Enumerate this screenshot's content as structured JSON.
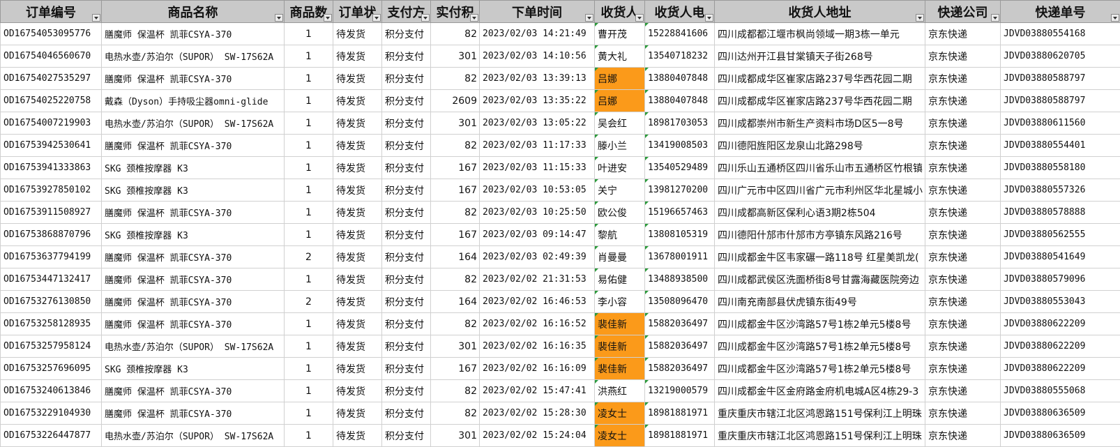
{
  "headers": [
    "订单编号",
    "商品名称",
    "商品数",
    "订单状",
    "支付方",
    "实付积",
    "下单时间",
    "收货人",
    "收货人电",
    "收货人地址",
    "快递公司",
    "快递单号"
  ],
  "rows": [
    {
      "order_id": "OD16754053095776",
      "product": "膳魔师 保温杯 凯菲CSYA-370",
      "qty": "1",
      "status": "待发货",
      "pay": "积分支付",
      "points": "82",
      "time": "2023/02/03 14:21:49",
      "name": "曹开茂",
      "phone": "15228841606",
      "address": "四川成都都江堰市枫尚领域一期3栋一单元",
      "courier": "京东快递",
      "tracking": "JDVD03880554168",
      "name_highlight": false
    },
    {
      "order_id": "OD16754046560670",
      "product": "电热水壶/苏泊尔（SUPOR） SW-17S62A",
      "qty": "1",
      "status": "待发货",
      "pay": "积分支付",
      "points": "301",
      "time": "2023/02/03 14:10:56",
      "name": "黄大礼",
      "phone": "13540718232",
      "address": "四川达州开江县甘棠镇天子街268号",
      "courier": "京东快递",
      "tracking": "JDVD03880620705",
      "name_highlight": false
    },
    {
      "order_id": "OD16754027535297",
      "product": "膳魔师 保温杯 凯菲CSYA-370",
      "qty": "1",
      "status": "待发货",
      "pay": "积分支付",
      "points": "82",
      "time": "2023/02/03 13:39:13",
      "name": "吕娜",
      "phone": "13880407848",
      "address": "四川成都成华区崔家店路237号华西花园二期",
      "courier": "京东快递",
      "tracking": "JDVD03880588797",
      "name_highlight": true
    },
    {
      "order_id": "OD16754025220758",
      "product": "戴森（Dyson）手持吸尘器omni-glide",
      "qty": "1",
      "status": "待发货",
      "pay": "积分支付",
      "points": "2609",
      "time": "2023/02/03 13:35:22",
      "name": "吕娜",
      "phone": "13880407848",
      "address": "四川成都成华区崔家店路237号华西花园二期",
      "courier": "京东快递",
      "tracking": "JDVD03880588797",
      "name_highlight": true
    },
    {
      "order_id": "OD16754007219903",
      "product": "电热水壶/苏泊尔（SUPOR） SW-17S62A",
      "qty": "1",
      "status": "待发货",
      "pay": "积分支付",
      "points": "301",
      "time": "2023/02/03 13:05:22",
      "name": "吴会红",
      "phone": "18981703053",
      "address": "四川成都崇州市新生产资料市场D区5一8号",
      "courier": "京东快递",
      "tracking": "JDVD03880611560",
      "name_highlight": false
    },
    {
      "order_id": "OD16753942530641",
      "product": "膳魔师 保温杯 凯菲CSYA-370",
      "qty": "1",
      "status": "待发货",
      "pay": "积分支付",
      "points": "82",
      "time": "2023/02/03 11:17:33",
      "name": "滕小兰",
      "phone": "13419008503",
      "address": "四川德阳旌阳区龙泉山北路298号",
      "courier": "京东快递",
      "tracking": "JDVD03880554401",
      "name_highlight": false
    },
    {
      "order_id": "OD16753941333863",
      "product": "SKG 颈椎按摩器 K3",
      "qty": "1",
      "status": "待发货",
      "pay": "积分支付",
      "points": "167",
      "time": "2023/02/03 11:15:33",
      "name": "叶进安",
      "phone": "13540529489",
      "address": "四川乐山五通桥区四川省乐山市五通桥区竹根镇",
      "courier": "京东快递",
      "tracking": "JDVD03880558180",
      "name_highlight": false
    },
    {
      "order_id": "OD16753927850102",
      "product": "SKG 颈椎按摩器 K3",
      "qty": "1",
      "status": "待发货",
      "pay": "积分支付",
      "points": "167",
      "time": "2023/02/03 10:53:05",
      "name": "关宁",
      "phone": "13981270200",
      "address": "四川广元市中区四川省广元市利州区华北星城小",
      "courier": "京东快递",
      "tracking": "JDVD03880557326",
      "name_highlight": false
    },
    {
      "order_id": "OD16753911508927",
      "product": "膳魔师 保温杯 凯菲CSYA-370",
      "qty": "1",
      "status": "待发货",
      "pay": "积分支付",
      "points": "82",
      "time": "2023/02/03 10:25:50",
      "name": "欧公俊",
      "phone": "15196657463",
      "address": "四川成都高新区保利心语3期2栋504",
      "courier": "京东快递",
      "tracking": "JDVD03880578888",
      "name_highlight": false
    },
    {
      "order_id": "OD16753868870796",
      "product": "SKG 颈椎按摩器 K3",
      "qty": "1",
      "status": "待发货",
      "pay": "积分支付",
      "points": "167",
      "time": "2023/02/03 09:14:47",
      "name": "黎航",
      "phone": "13808105319",
      "address": "四川德阳什邡市什邡市方亭镇东风路216号",
      "courier": "京东快递",
      "tracking": "JDVD03880562555",
      "name_highlight": false
    },
    {
      "order_id": "OD16753637794199",
      "product": "膳魔师 保温杯 凯菲CSYA-370",
      "qty": "2",
      "status": "待发货",
      "pay": "积分支付",
      "points": "164",
      "time": "2023/02/03 02:49:39",
      "name": "肖曼曼",
      "phone": "13678001911",
      "address": "四川成都金牛区韦家碾一路118号 红星美凯龙(",
      "courier": "京东快递",
      "tracking": "JDVD03880541649",
      "name_highlight": false
    },
    {
      "order_id": "OD16753447132417",
      "product": "膳魔师 保温杯 凯菲CSYA-370",
      "qty": "1",
      "status": "待发货",
      "pay": "积分支付",
      "points": "82",
      "time": "2023/02/02 21:31:53",
      "name": "易佑健",
      "phone": "13488938500",
      "address": "四川成都武侯区洗面桥街8号甘露海藏医院旁边",
      "courier": "京东快递",
      "tracking": "JDVD03880579096",
      "name_highlight": false
    },
    {
      "order_id": "OD16753276130850",
      "product": "膳魔师 保温杯 凯菲CSYA-370",
      "qty": "2",
      "status": "待发货",
      "pay": "积分支付",
      "points": "164",
      "time": "2023/02/02 16:46:53",
      "name": "李小容",
      "phone": "13508096470",
      "address": "四川南充南部县伏虎镇东街49号",
      "courier": "京东快递",
      "tracking": "JDVD03880553043",
      "name_highlight": false
    },
    {
      "order_id": "OD16753258128935",
      "product": "膳魔师 保温杯 凯菲CSYA-370",
      "qty": "1",
      "status": "待发货",
      "pay": "积分支付",
      "points": "82",
      "time": "2023/02/02 16:16:52",
      "name": "裴佳新",
      "phone": "15882036497",
      "address": "四川成都金牛区沙湾路57号1栋2单元5楼8号",
      "courier": "京东快递",
      "tracking": "JDVD03880622209",
      "name_highlight": true
    },
    {
      "order_id": "OD16753257958124",
      "product": "电热水壶/苏泊尔（SUPOR） SW-17S62A",
      "qty": "1",
      "status": "待发货",
      "pay": "积分支付",
      "points": "301",
      "time": "2023/02/02 16:16:35",
      "name": "裴佳新",
      "phone": "15882036497",
      "address": "四川成都金牛区沙湾路57号1栋2单元5楼8号",
      "courier": "京东快递",
      "tracking": "JDVD03880622209",
      "name_highlight": true
    },
    {
      "order_id": "OD16753257696095",
      "product": "SKG 颈椎按摩器 K3",
      "qty": "1",
      "status": "待发货",
      "pay": "积分支付",
      "points": "167",
      "time": "2023/02/02 16:16:09",
      "name": "裴佳新",
      "phone": "15882036497",
      "address": "四川成都金牛区沙湾路57号1栋2单元5楼8号",
      "courier": "京东快递",
      "tracking": "JDVD03880622209",
      "name_highlight": true
    },
    {
      "order_id": "OD16753240613846",
      "product": "膳魔师 保温杯 凯菲CSYA-370",
      "qty": "1",
      "status": "待发货",
      "pay": "积分支付",
      "points": "82",
      "time": "2023/02/02 15:47:41",
      "name": "洪燕红",
      "phone": "13219000579",
      "address": "四川成都金牛区金府路金府机电城A区4栋29-3",
      "courier": "京东快递",
      "tracking": "JDVD03880555068",
      "name_highlight": false
    },
    {
      "order_id": "OD16753229104930",
      "product": "膳魔师 保温杯 凯菲CSYA-370",
      "qty": "1",
      "status": "待发货",
      "pay": "积分支付",
      "points": "82",
      "time": "2023/02/02 15:28:30",
      "name": "凌女士",
      "phone": "18981881971",
      "address": "重庆重庆市辖江北区鸿恩路151号保利江上明珠",
      "courier": "京东快递",
      "tracking": "JDVD03880636509",
      "name_highlight": true
    },
    {
      "order_id": "OD16753226447877",
      "product": "电热水壶/苏泊尔（SUPOR） SW-17S62A",
      "qty": "1",
      "status": "待发货",
      "pay": "积分支付",
      "points": "301",
      "time": "2023/02/02 15:24:04",
      "name": "凌女士",
      "phone": "18981881971",
      "address": "重庆重庆市辖江北区鸿恩路151号保利江上明珠",
      "courier": "京东快递",
      "tracking": "JDVD03880636509",
      "name_highlight": true
    }
  ],
  "colors": {
    "header_bg": "#c9c9c9",
    "highlight": "#fb9a1a",
    "comment_marker": "#2a9a3a"
  },
  "icons": {
    "filter": "filter-dropdown-icon",
    "comment": "comment-marker-icon"
  }
}
